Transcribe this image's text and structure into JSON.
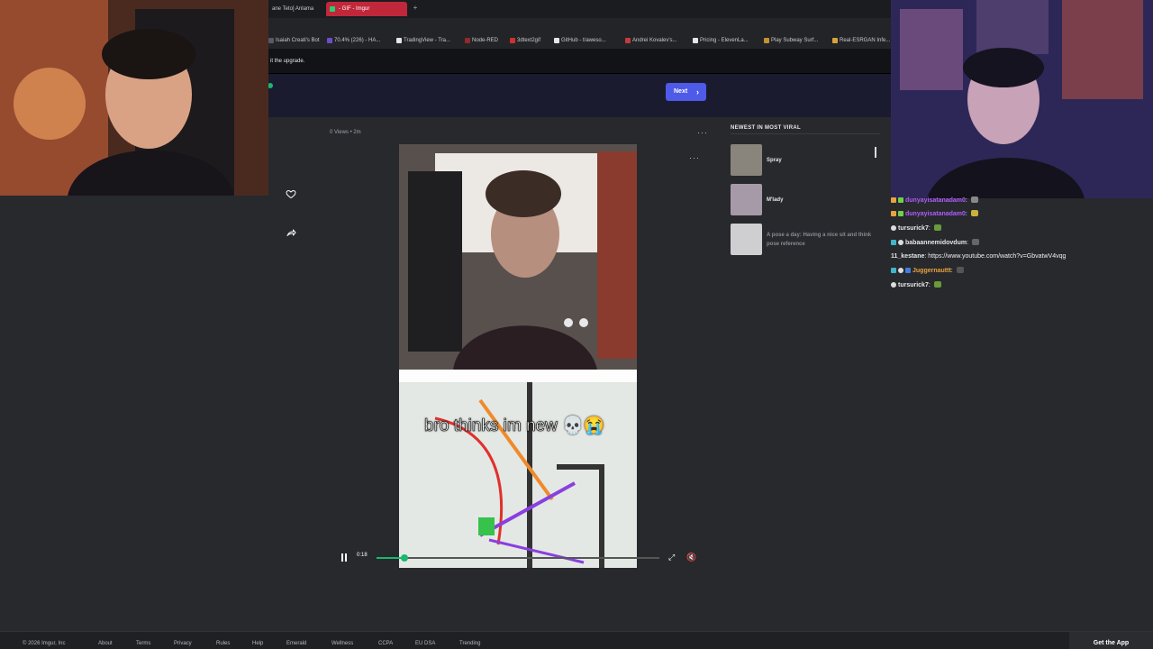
{
  "browser": {
    "tabs": [
      {
        "label": "ane Teto] Anlama"
      },
      {
        "label": "- GIF - Imgur",
        "active": true
      }
    ],
    "new_tab": "+",
    "bookmarks": [
      {
        "label": "Isaiah Creati's Bot",
        "color": "#555b66"
      },
      {
        "label": "70.4% (226) - HA...",
        "color": "#6e4cc9"
      },
      {
        "label": "TradingView - Tra...",
        "color": "#e6e6e6"
      },
      {
        "label": "Node-RED",
        "color": "#8f2b2b"
      },
      {
        "label": "3dtext2gif",
        "color": "#d0312d"
      },
      {
        "label": "GitHub - t/aweso...",
        "color": "#e6e6e6"
      },
      {
        "label": "Andrei Kovalev's...",
        "color": "#c43b3b"
      },
      {
        "label": "Pricing - ElevenLa...",
        "color": "#e6e6e6"
      },
      {
        "label": "Play Subway Surf...",
        "color": "#c4912f"
      },
      {
        "label": "Real-ESRGAN Infe...",
        "color": "#d8a43a"
      }
    ],
    "infobar_text": "it the upgrade."
  },
  "imgur": {
    "next_label": "Next",
    "post_meta": "0 Views • 2m",
    "caption_overlay": "bro thinks im new 💀😭",
    "video_time": "0:18",
    "progress_fraction": 0.1,
    "viral_heading": "NEWEST IN MOST VIRAL",
    "viral_items": [
      {
        "title": "Spray",
        "color": "#8a857c"
      },
      {
        "title": "M'lady",
        "color": "#a69aa8"
      },
      {
        "title": "A pose a day: Having a nice sit and think pose reference",
        "color": "#cfcfd2"
      }
    ],
    "footer_links": [
      "© 2026 Imgur, Inc",
      "About",
      "Terms",
      "Privacy",
      "Rules",
      "Help",
      "Emerald",
      "Wellness",
      "CCPA",
      "EU DSA",
      "Trending"
    ],
    "get_app": "Get the App",
    "accent": "#1bb76e"
  },
  "chat": {
    "messages": [
      {
        "user": "dunyayisatanadam0",
        "text": "",
        "color": "#b05cff",
        "badges": [
          "#e8a33c",
          "#6fd04a"
        ],
        "emote": "#888"
      },
      {
        "user": "dunyayisatanadam0",
        "text": "",
        "color": "#b05cff",
        "badges": [
          "#e8a33c",
          "#6fd04a"
        ],
        "emote": "#c9b23b"
      },
      {
        "user": "tursurick7",
        "text": "",
        "color": "#e6e6e6",
        "badges": [
          "#dddddd"
        ],
        "emote": "#6a9a3a"
      },
      {
        "user": "babaannemidovdum",
        "text": "",
        "color": "#e6e6e6",
        "badges": [
          "#3fb6c9",
          "#dddddd"
        ],
        "emote": "#666"
      },
      {
        "user": "11_kestane",
        "text": "https://www.youtube.com/watch?v=GbvatwV4vqg",
        "color": "#e6e6e6",
        "badges": [],
        "emote": ""
      },
      {
        "user": "Juggernauttt",
        "text": "",
        "color": "#e8a33c",
        "badges": [
          "#3fb6c9",
          "#dddddd",
          "#3f7fd9"
        ],
        "emote": "#555"
      },
      {
        "user": "tursurick7",
        "text": "",
        "color": "#e6e6e6",
        "badges": [
          "#dddddd"
        ],
        "emote": "#6a9a3a"
      }
    ]
  }
}
